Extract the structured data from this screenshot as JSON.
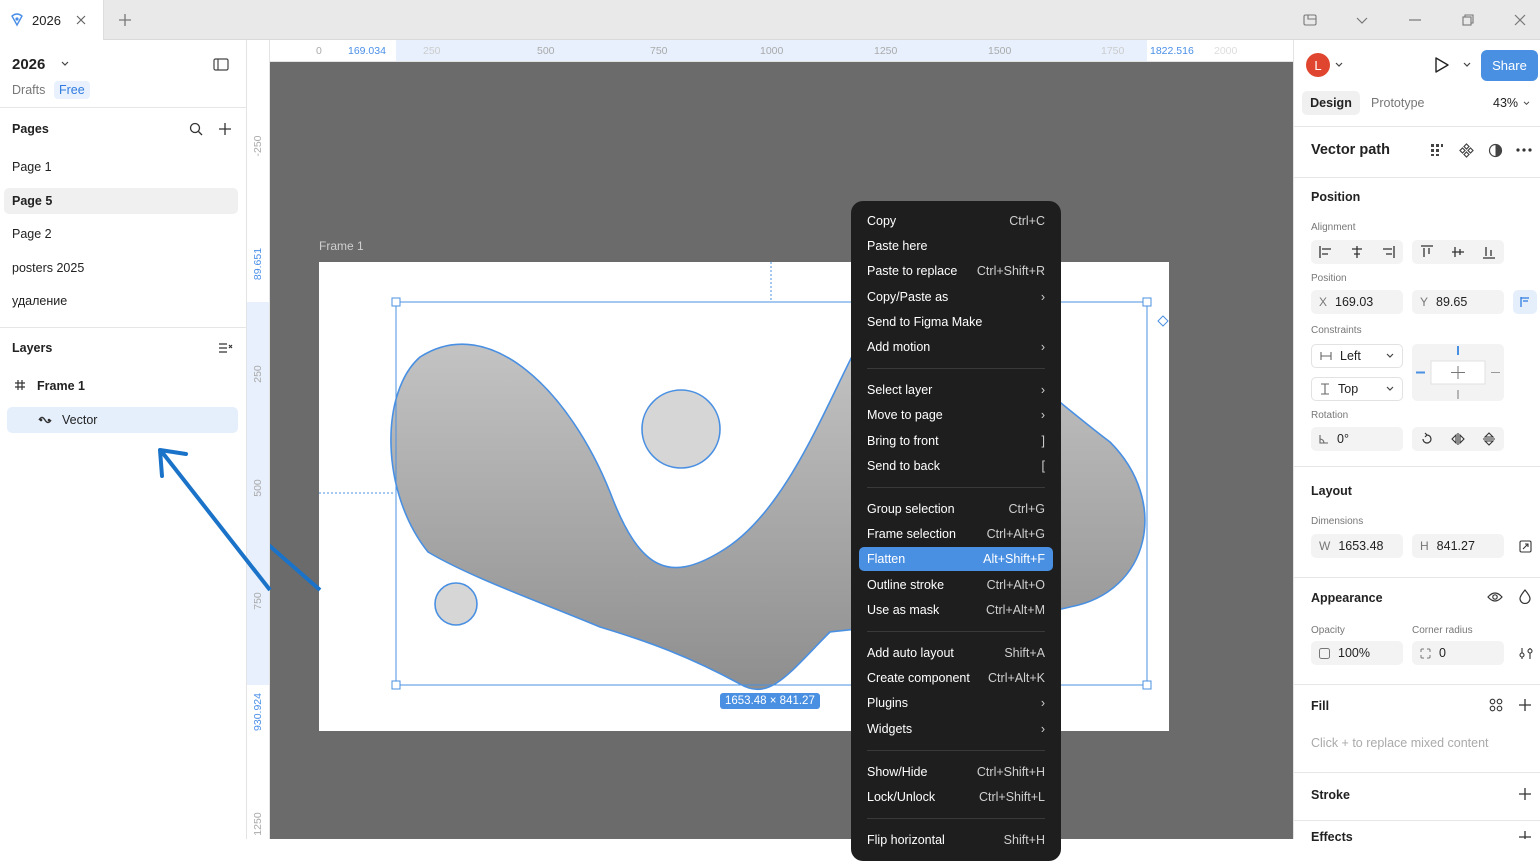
{
  "tab": {
    "title": "2026"
  },
  "file": {
    "name": "2026",
    "location": "Drafts",
    "plan": "Free"
  },
  "pages": {
    "title": "Pages",
    "items": [
      "Page 1",
      "Page 5",
      "Page 2",
      "posters 2025",
      "удаление"
    ]
  },
  "layers": {
    "title": "Layers",
    "frame": "Frame 1",
    "child": "Vector"
  },
  "ruler_h": {
    "start": "169.034",
    "end": "1822.516",
    "ticks": [
      "250",
      "500",
      "750",
      "1000",
      "1250",
      "1500",
      "1750",
      "2000",
      "0"
    ]
  },
  "ruler_v": {
    "start": "89.651",
    "end": "930.924",
    "ticks": [
      "-250",
      "250",
      "500",
      "750",
      "1250"
    ]
  },
  "canvas": {
    "frame_label": "Frame 1",
    "size_badge": "1653.48 × 841.27"
  },
  "context_menu": {
    "groups": [
      [
        {
          "label": "Copy",
          "shortcut": "Ctrl+C"
        },
        {
          "label": "Paste here",
          "shortcut": ""
        },
        {
          "label": "Paste to replace",
          "shortcut": "Ctrl+Shift+R"
        },
        {
          "label": "Copy/Paste as",
          "shortcut": "›"
        },
        {
          "label": "Send to Figma Make",
          "shortcut": ""
        },
        {
          "label": "Add motion",
          "shortcut": "›"
        }
      ],
      [
        {
          "label": "Select layer",
          "shortcut": "›"
        },
        {
          "label": "Move to page",
          "shortcut": "›"
        },
        {
          "label": "Bring to front",
          "shortcut": "]"
        },
        {
          "label": "Send to back",
          "shortcut": "["
        }
      ],
      [
        {
          "label": "Group selection",
          "shortcut": "Ctrl+G"
        },
        {
          "label": "Frame selection",
          "shortcut": "Ctrl+Alt+G"
        },
        {
          "label": "Flatten",
          "shortcut": "Alt+Shift+F"
        },
        {
          "label": "Outline stroke",
          "shortcut": "Ctrl+Alt+O"
        },
        {
          "label": "Use as mask",
          "shortcut": "Ctrl+Alt+M"
        }
      ],
      [
        {
          "label": "Add auto layout",
          "shortcut": "Shift+A"
        },
        {
          "label": "Create component",
          "shortcut": "Ctrl+Alt+K"
        },
        {
          "label": "Plugins",
          "shortcut": "›"
        },
        {
          "label": "Widgets",
          "shortcut": "›"
        }
      ],
      [
        {
          "label": "Show/Hide",
          "shortcut": "Ctrl+Shift+H"
        },
        {
          "label": "Lock/Unlock",
          "shortcut": "Ctrl+Shift+L"
        }
      ],
      [
        {
          "label": "Flip horizontal",
          "shortcut": "Shift+H"
        }
      ]
    ]
  },
  "header_right": {
    "avatar": "L",
    "share": "Share",
    "tabs": [
      "Design",
      "Prototype"
    ],
    "zoom": "43%"
  },
  "design": {
    "layer_type": "Vector path",
    "position": {
      "title": "Position",
      "alignment_label": "Alignment",
      "position_label": "Position",
      "x_key": "X",
      "x": "169.03",
      "y_key": "Y",
      "y": "89.65",
      "constraints_label": "Constraints",
      "h_constraint": "Left",
      "v_constraint": "Top",
      "rotation_label": "Rotation",
      "rotation": "0°"
    },
    "layout": {
      "title": "Layout",
      "dimensions_label": "Dimensions",
      "w_key": "W",
      "w": "1653.48",
      "h_key": "H",
      "h": "841.27"
    },
    "appearance": {
      "title": "Appearance",
      "opacity_label": "Opacity",
      "opacity": "100%",
      "radius_label": "Corner radius",
      "radius": "0"
    },
    "fill": {
      "title": "Fill",
      "hint": "Click + to replace mixed content"
    },
    "stroke": {
      "title": "Stroke"
    },
    "effects": {
      "title": "Effects"
    }
  },
  "colors": {
    "accent": "#4a90e2",
    "canvas": "#6b6b6b",
    "menu_bg": "#1e1e1e",
    "arrow": "#1a73c8",
    "avatar": "#e0462f"
  }
}
